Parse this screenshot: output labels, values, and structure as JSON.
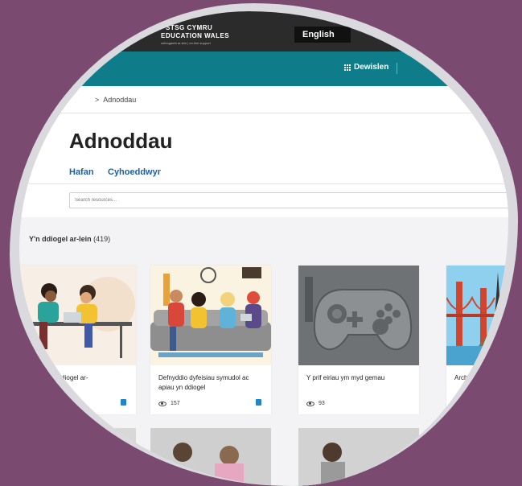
{
  "header": {
    "logo_line1": "STSG CYMRU",
    "logo_line2": "EDUCATION WALES",
    "logo_line3": "cefnogaeth ar-lein | on-line support",
    "language_button": "English"
  },
  "nav": {
    "menu_label": "Dewislen"
  },
  "breadcrumb": {
    "separator": ">",
    "current": "Adnoddau"
  },
  "page": {
    "title": "Adnoddau",
    "tabs": [
      {
        "label": "Hafan"
      },
      {
        "label": "Cyhoeddwyr"
      }
    ],
    "search_placeholder": "Search resources..."
  },
  "results": {
    "heading": "Y'n ddiogel ar-lein",
    "count": "(419)"
  },
  "cards": [
    {
      "title": "plant chi yn ddiogel ar-",
      "views": ""
    },
    {
      "title": "Defnyddio dyfeisiau symudol ac apiau yn ddiogel",
      "views": "157"
    },
    {
      "title": "Y prif eiriau ym myd gemau",
      "views": "93"
    },
    {
      "title": "Archc",
      "views": ""
    }
  ],
  "colors": {
    "background": "#7a4a70",
    "topbar": "#2b2b2b",
    "navbar": "#0f7c8a",
    "link": "#1a5fa8",
    "badge": "#1f86c9"
  }
}
